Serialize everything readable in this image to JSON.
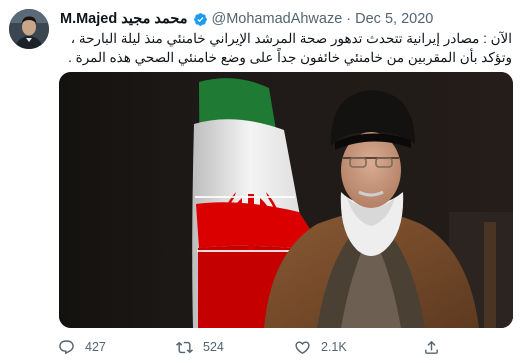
{
  "author": {
    "display_name_ar": "محمد مجید",
    "display_name_en": "M.Majed",
    "handle": "@MohamadAhwaze",
    "avatar_icon": "profile-avatar",
    "verified_icon": "verified-badge-icon"
  },
  "meta": {
    "separator": "·",
    "date": "Dec 5, 2020"
  },
  "tweet": {
    "line1": "الآن : مصادر إيرانية تتحدث تدهور صحة المرشد الإيراني خامنئي منذ ليلة البارحة ،",
    "line2": "وتؤكد بأن المقربين من خامنئي خائفون جداً على وضع خامنئي الصحي هذه المرة ."
  },
  "actions": {
    "reply_count": "427",
    "retweet_count": "524",
    "like_count": "2.1K",
    "reply_icon": "reply-icon",
    "retweet_icon": "retweet-icon",
    "like_icon": "heart-icon",
    "share_icon": "share-icon"
  },
  "colors": {
    "text_primary": "#0f1419",
    "text_secondary": "#536471",
    "verified_blue": "#1d9bf0",
    "flag_green": "#239f40",
    "flag_red": "#da0000"
  }
}
